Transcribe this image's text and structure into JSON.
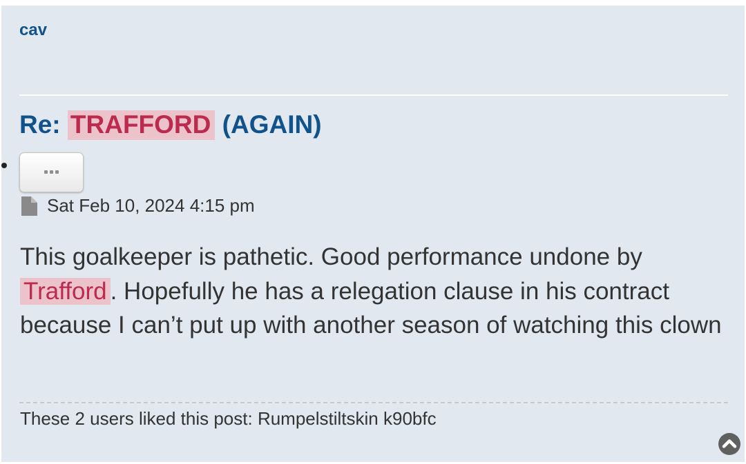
{
  "post": {
    "author": "cav",
    "title_prefix": "Re: ",
    "title_highlight": "TRAFFORD",
    "title_suffix": " (AGAIN)",
    "more_button_icon": "ellipsis-icon",
    "date_icon": "file-icon",
    "date": "Sat Feb 10, 2024 4:15 pm",
    "content_before": "This goalkeeper is pathetic. Good performance undone by ",
    "content_highlight": "Trafford",
    "content_after": ". Hopefully he has a relegation clause in his contract because I can’t put up with another season of watching this clown",
    "likes": "These 2 users liked this post: Rumpelstiltskin k90bfc",
    "top_icon": "chevron-up-circle-icon"
  },
  "colors": {
    "panel_bg": "#e1e8ef",
    "link": "#105289",
    "highlight_bg": "#ecc2cb",
    "highlight_text": "#bc2a4d",
    "text": "#333333"
  }
}
